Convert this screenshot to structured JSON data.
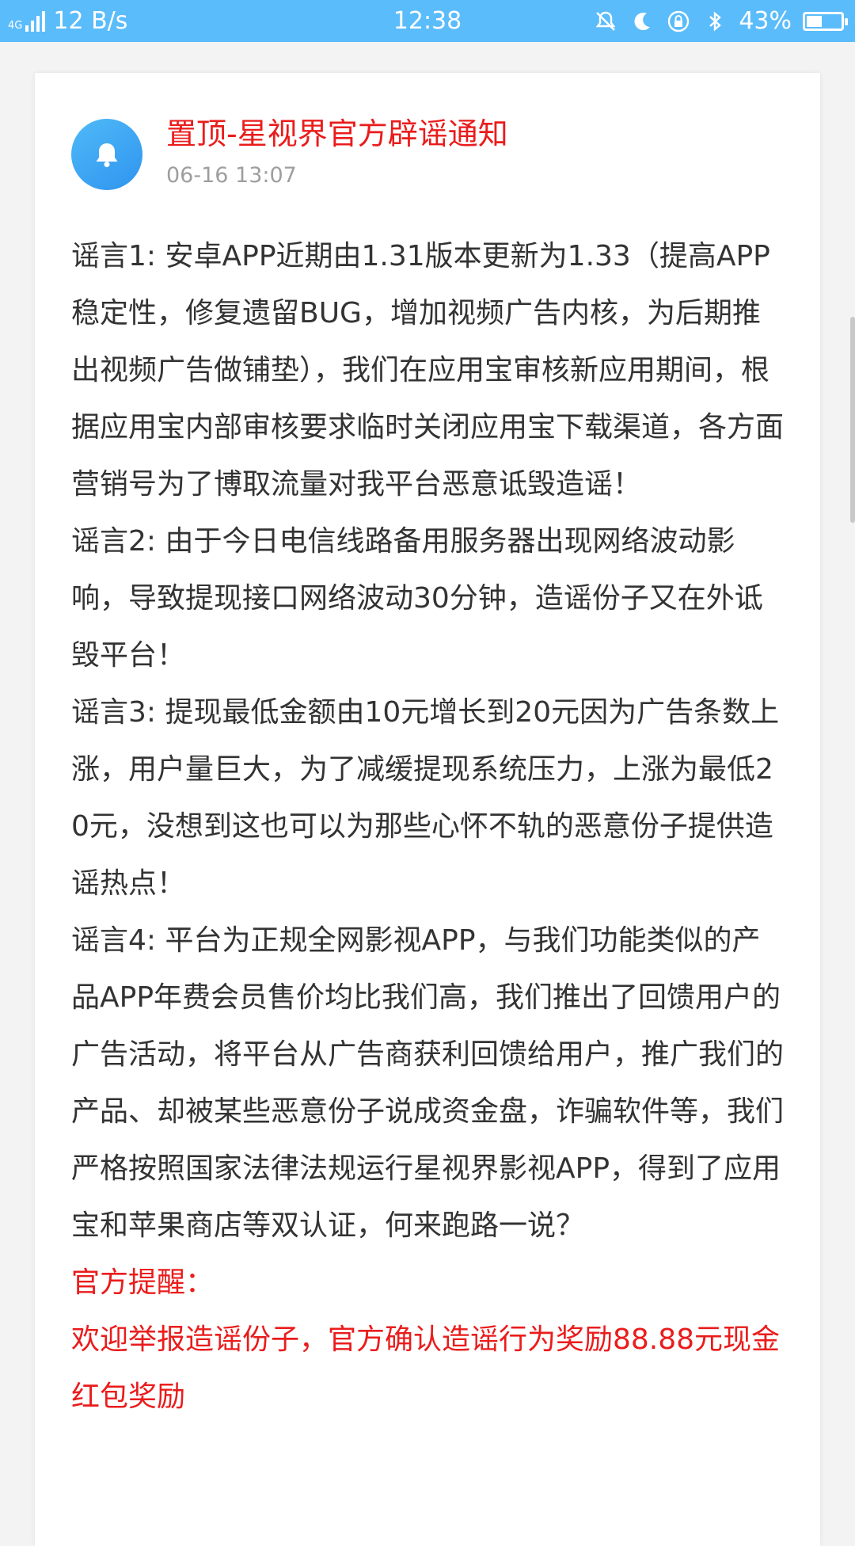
{
  "status_bar": {
    "network_type": "4G",
    "net_speed": "12 B/s",
    "time": "12:38",
    "battery": "43%",
    "battery_level": 0.43,
    "color": "#5bbcfb"
  },
  "post": {
    "avatar_icon": "bell-icon",
    "title": "置顶-星视界官方辟谣通知",
    "time": "06-16 13:07",
    "title_color": "#ea1c1c",
    "paragraphs": [
      "谣言1: 安卓APP近期由1.31版本更新为1.33（提高APP稳定性，修复遗留BUG，增加视频广告内核，为后期推出视频广告做铺垫），我们在应用宝审核新应用期间，根据应用宝内部审核要求临时关闭应用宝下载渠道，各方面营销号为了博取流量对我平台恶意诋毁造谣！",
      "谣言2: 由于今日电信线路备用服务器出现网络波动影响，导致提现接口网络波动30分钟，造谣份子又在外诋毁平台！",
      "谣言3: 提现最低金额由10元增长到20元因为广告条数上涨，用户量巨大，为了减缓提现系统压力，上涨为最低20元，没想到这也可以为那些心怀不轨的恶意份子提供造谣热点！",
      "谣言4: 平台为正规全网影视APP，与我们功能类似的产品APP年费会员售价均比我们高，我们推出了回馈用户的广告活动，将平台从广告商获利回馈给用户，推广我们的产品、却被某些恶意份子说成资金盘，诈骗软件等，我们严格按照国家法律法规运行星视界影视APP，得到了应用宝和苹果商店等双认证，何来跑路一说？"
    ],
    "reminder_label": "官方提醒：",
    "reminder_text": "欢迎举报造谣份子，官方确认造谣行为奖励88.88元现金红包奖励"
  }
}
